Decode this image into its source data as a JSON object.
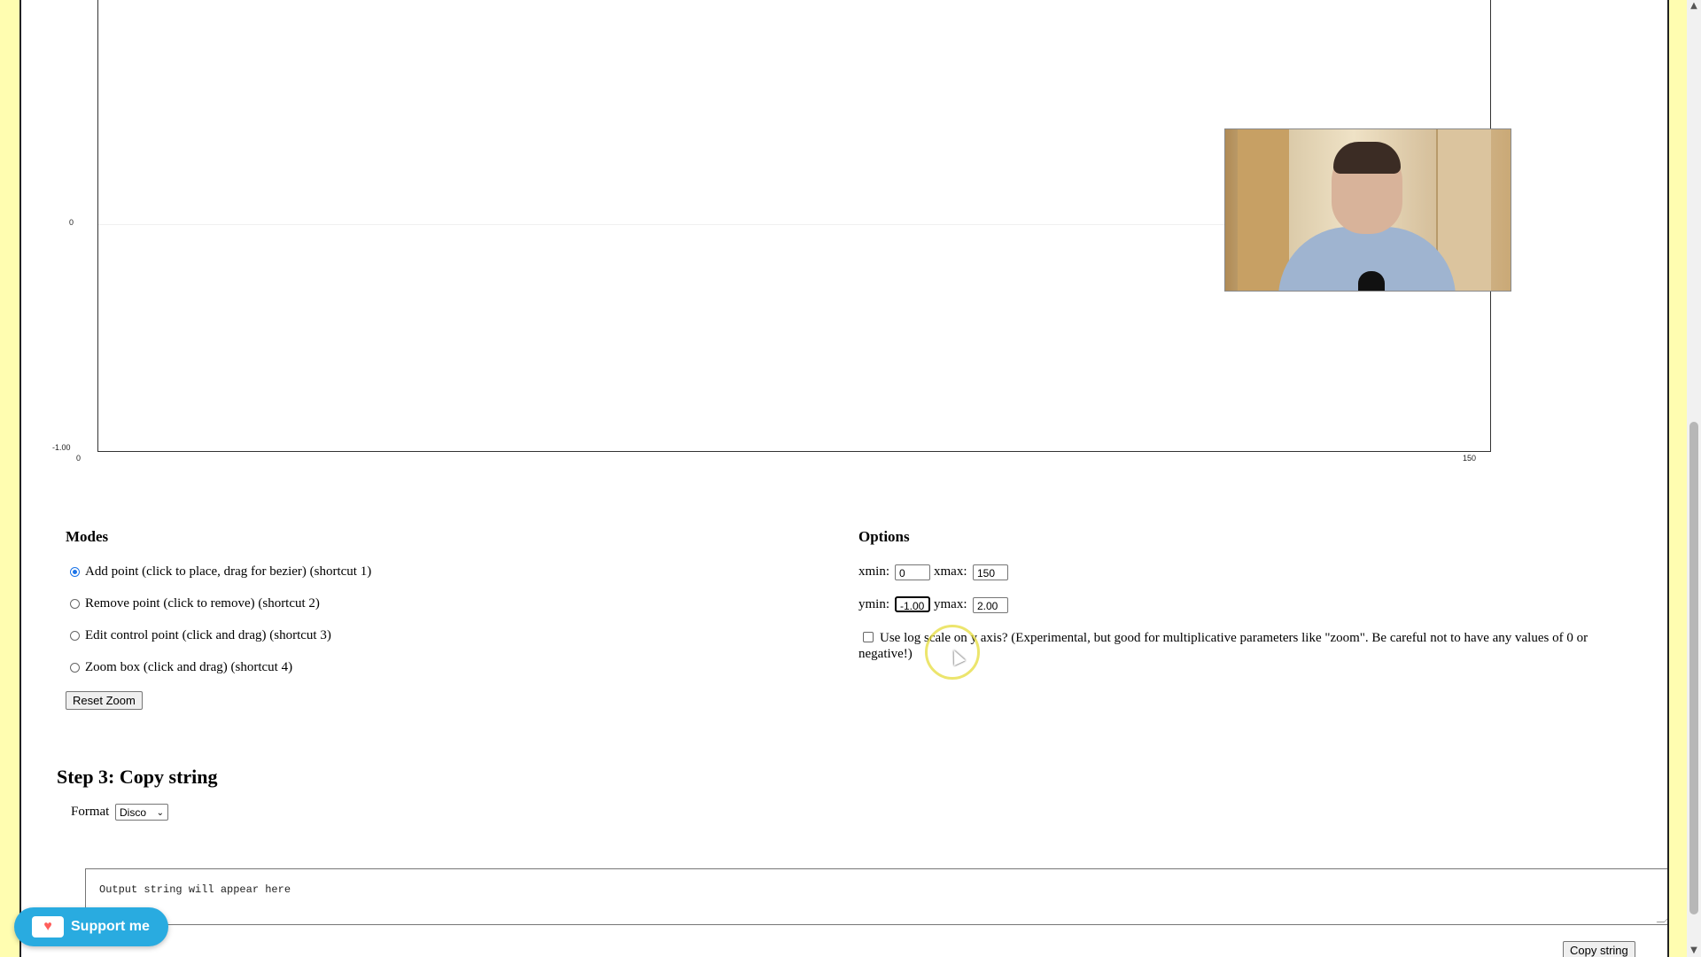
{
  "chart": {
    "y_tick_top": "0",
    "y_tick_bottom": "-1.00",
    "x_tick_left": "0",
    "x_tick_right": "150"
  },
  "modes": {
    "title": "Modes",
    "items": [
      {
        "label": "Add point (click to place, drag for bezier) (shortcut 1)",
        "selected": true
      },
      {
        "label": "Remove point (click to remove) (shortcut 2)",
        "selected": false
      },
      {
        "label": "Edit control point (click and drag) (shortcut 3)",
        "selected": false
      },
      {
        "label": "Zoom box (click and drag) (shortcut 4)",
        "selected": false
      }
    ],
    "reset_label": "Reset Zoom"
  },
  "options": {
    "title": "Options",
    "xmin_label": "xmin:",
    "xmin_value": "0",
    "xmax_label": "xmax:",
    "xmax_value": "150",
    "ymin_label": "ymin:",
    "ymin_value": "-1.00",
    "ymax_label": "ymax:",
    "ymax_value": "2.00",
    "log_scale_text": "Use log scale on y axis? (Experimental, but good for multiplicative parameters like \"zoom\". Be careful not to have any values of 0 or negative!)",
    "log_scale_checked": false
  },
  "step3": {
    "title": "Step 3: Copy string",
    "format_label": "Format",
    "format_value": "Disco",
    "output_placeholder": "Output string will appear here",
    "copy_label": "Copy string"
  },
  "support": {
    "label": "Support me",
    "icon": "ko-fi-cup-icon"
  },
  "colors": {
    "background": "#fffdb0",
    "support_button": "#29abe0",
    "radio_accent": "#1a73e8"
  }
}
